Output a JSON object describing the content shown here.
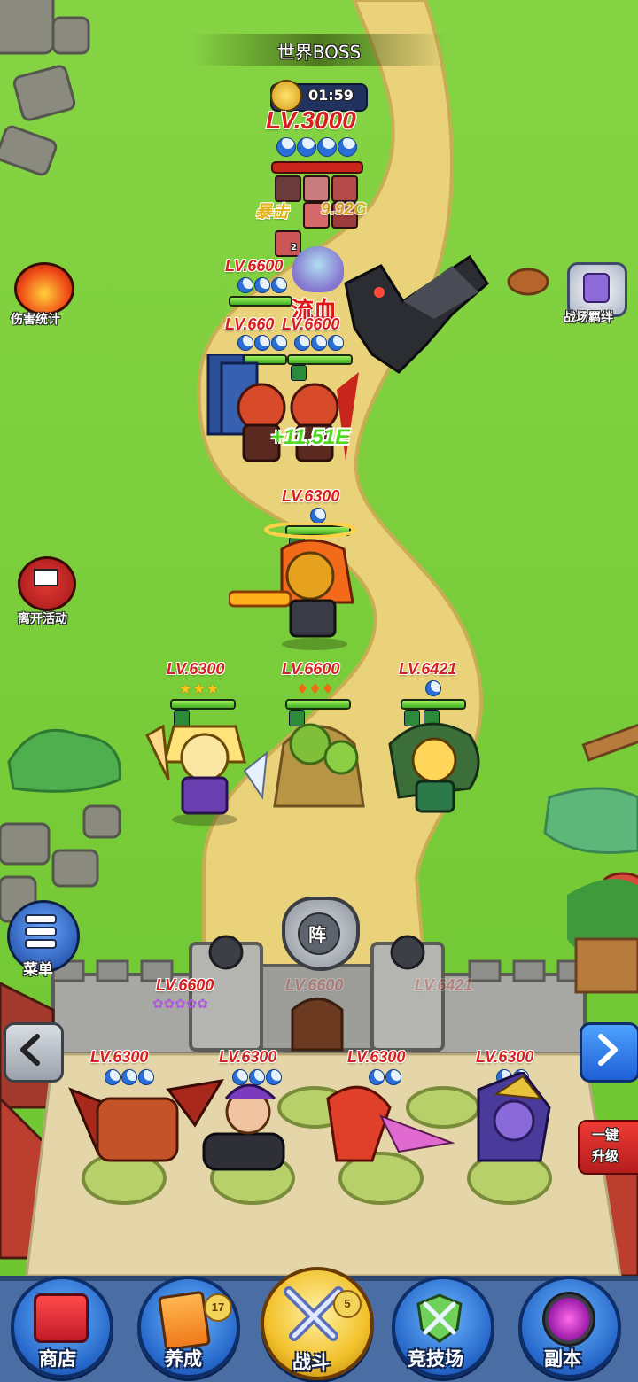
{
  "header": {
    "title": "世界BOSS",
    "timer": "01:59"
  },
  "boss": {
    "level": "LV.3000",
    "moon_count": 4,
    "crit_label": "暴击",
    "damage_text": "9.92G",
    "debuff_count": "2"
  },
  "floating": {
    "bleed_text": "流血",
    "heal_text": "+11.51E"
  },
  "left_side": {
    "damage_stats": "伤害统计",
    "leave_event": "离开活动"
  },
  "right_side": {
    "arena_bond": "战场羁绊",
    "one_key_upgrade_line1": "一键",
    "one_key_upgrade_line2": "升级"
  },
  "units": {
    "enemy_a": {
      "level": "LV.6600"
    },
    "enemy_b": {
      "level": "LV.660"
    },
    "enemy_c": {
      "level": "LV.6600"
    },
    "center_hero": {
      "level": "LV.6300"
    },
    "left_hero": {
      "level": "LV.6300"
    },
    "tree_hero": {
      "level": "LV.6600"
    },
    "medusa_hero": {
      "level": "LV.6421"
    },
    "wall_hero": {
      "level": "LV.6600"
    },
    "wall_faded_1": {
      "level": "LV.6600"
    },
    "wall_faded_2": {
      "level": "LV.6421"
    },
    "slot1": {
      "level": "LV.6300"
    },
    "slot2": {
      "level": "LV.6300"
    },
    "slot3": {
      "level": "LV.6300"
    },
    "slot4": {
      "level": "LV.6300"
    }
  },
  "formation_button": "阵",
  "menu_label": "菜单",
  "nav": {
    "shop": "商店",
    "develop": "养成",
    "develop_badge": "17",
    "battle": "战斗",
    "battle_badge": "5",
    "arena": "竞技场",
    "dungeon": "副本"
  },
  "colors": {
    "grass": "#79d13c",
    "path": "#e9d27a",
    "level_red": "#d61f1f",
    "nav_blue": "#2566c9"
  }
}
